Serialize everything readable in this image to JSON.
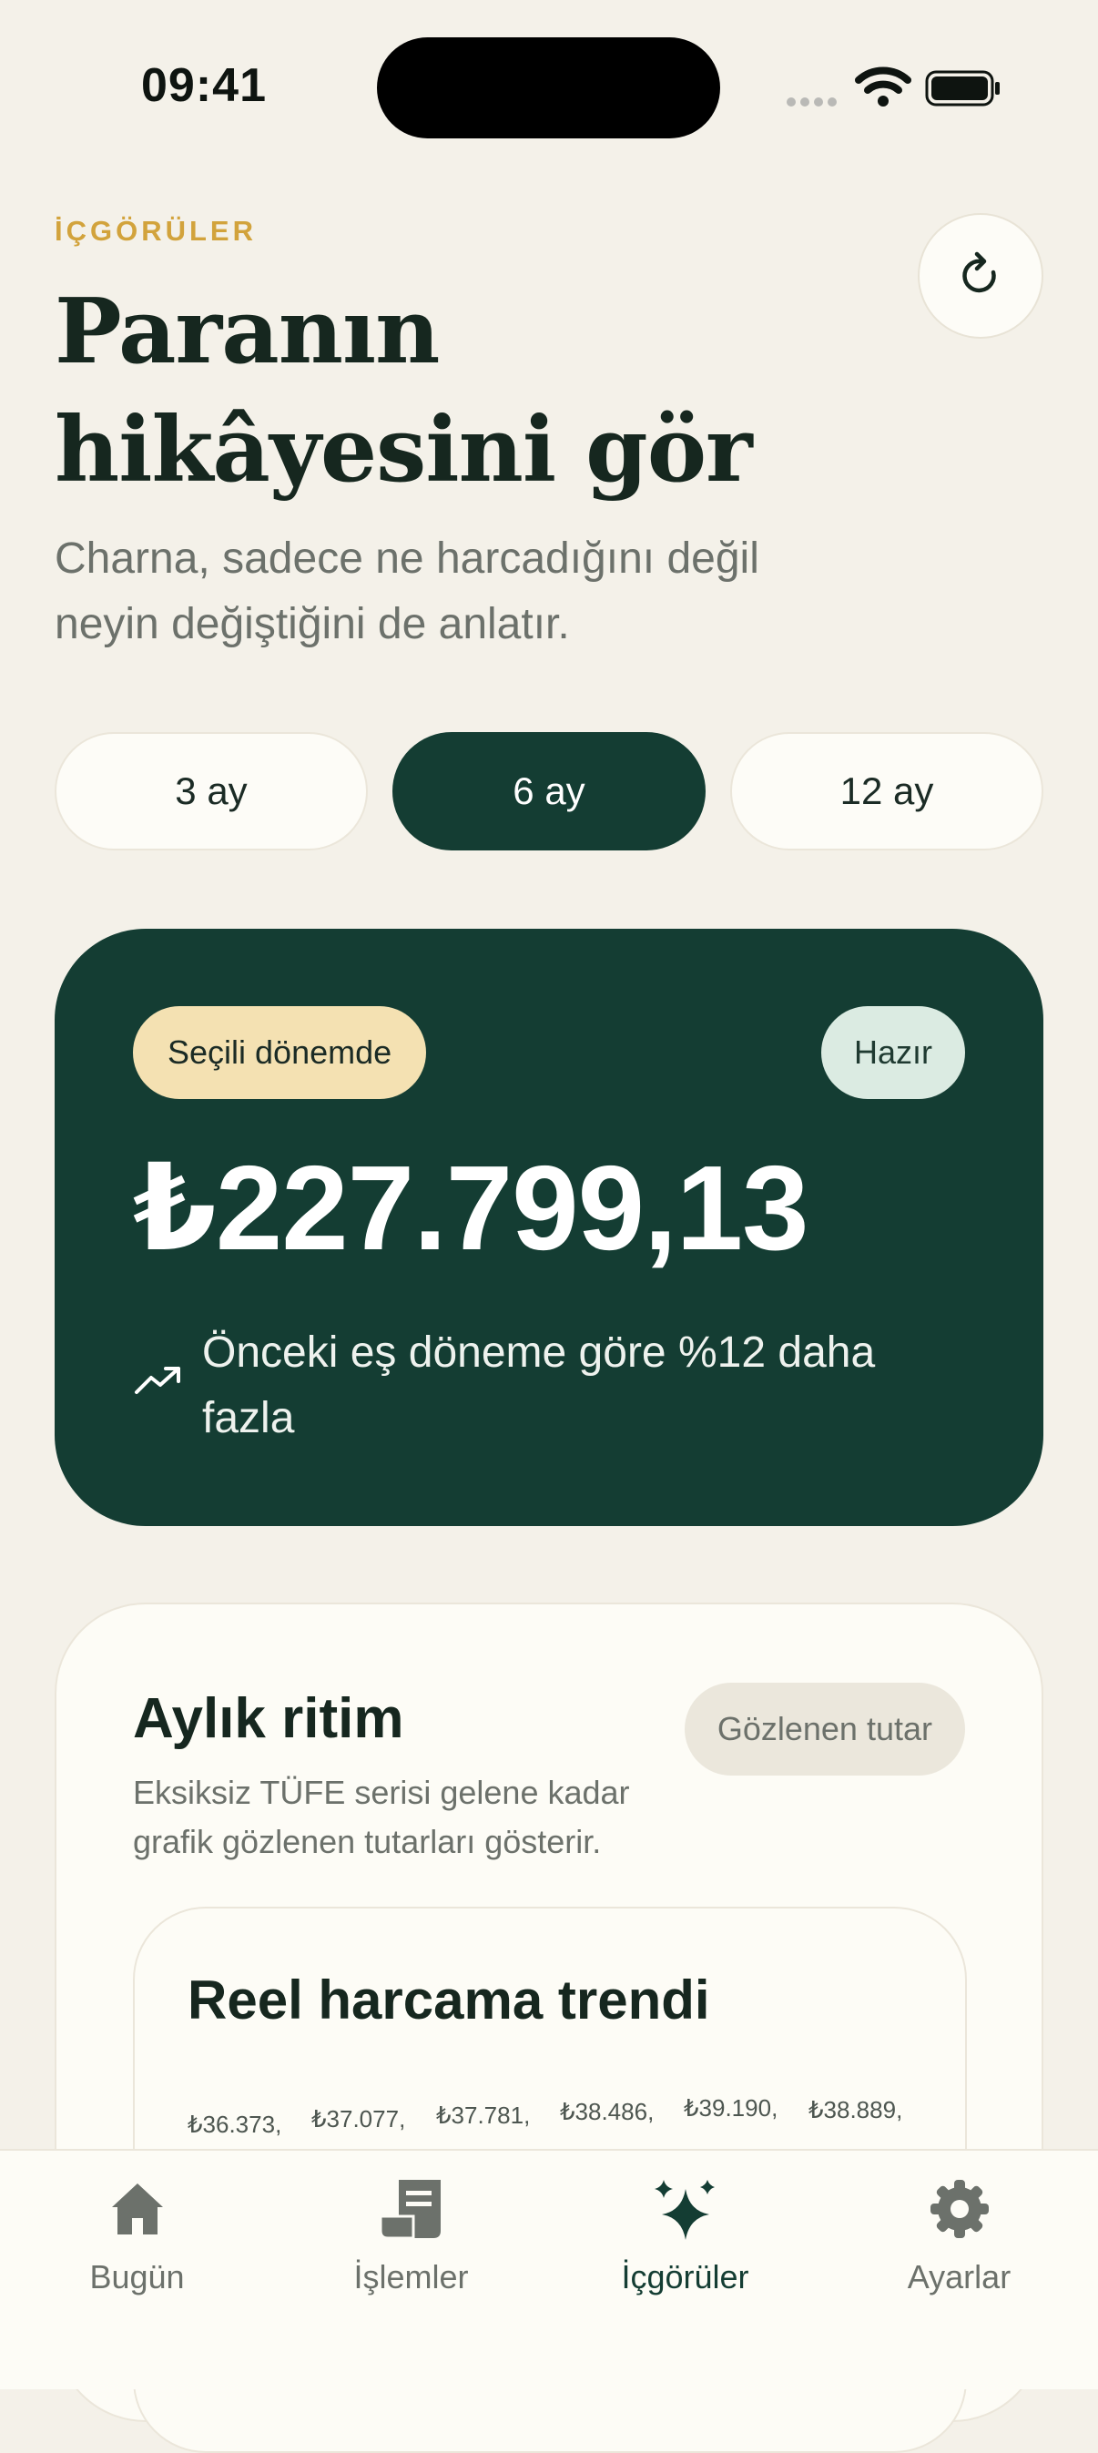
{
  "status_bar": {
    "time": "09:41"
  },
  "header": {
    "eyebrow": "İÇGÖRÜLER",
    "title_line1": "Paranın",
    "title_line2": "hikâyesini gör",
    "subtitle": "Charna, sadece ne harcadığını değil neyin değiştiğini de anlatır.",
    "refresh_icon": "refresh-icon"
  },
  "periods": [
    {
      "label": "3 ay",
      "active": false
    },
    {
      "label": "6 ay",
      "active": true
    },
    {
      "label": "12 ay",
      "active": false
    }
  ],
  "summary": {
    "period_badge": "Seçili dönemde",
    "status_badge": "Hazır",
    "amount": "₺227.799,13",
    "comparison": "Önceki eş döneme göre %12 daha fazla",
    "trend_icon": "trend-up-icon"
  },
  "rhythm": {
    "title": "Aylık ritim",
    "badge": "Gözlenen tutar",
    "description": "Eksiksiz TÜFE serisi gelene kadar grafik gözlenen tutarları gösterir.",
    "trend_card": {
      "title": "Reel harcama trendi",
      "labels": [
        "₺36.373,",
        "₺37.077,",
        "₺37.781,",
        "₺38.486,",
        "₺39.190,",
        "₺38.889,"
      ]
    }
  },
  "tabbar": [
    {
      "label": "Bugün",
      "icon": "home-icon",
      "active": false
    },
    {
      "label": "İşlemler",
      "icon": "receipt-icon",
      "active": false
    },
    {
      "label": "İçgörüler",
      "icon": "sparkles-icon",
      "active": true
    },
    {
      "label": "Ayarlar",
      "icon": "gear-icon",
      "active": false
    }
  ],
  "colors": {
    "background": "#f4f1e9",
    "primary_green": "#143d33",
    "accent_gold": "#d2a33c",
    "badge_cream": "#f4e1b2",
    "badge_mint": "#dbebe2"
  }
}
